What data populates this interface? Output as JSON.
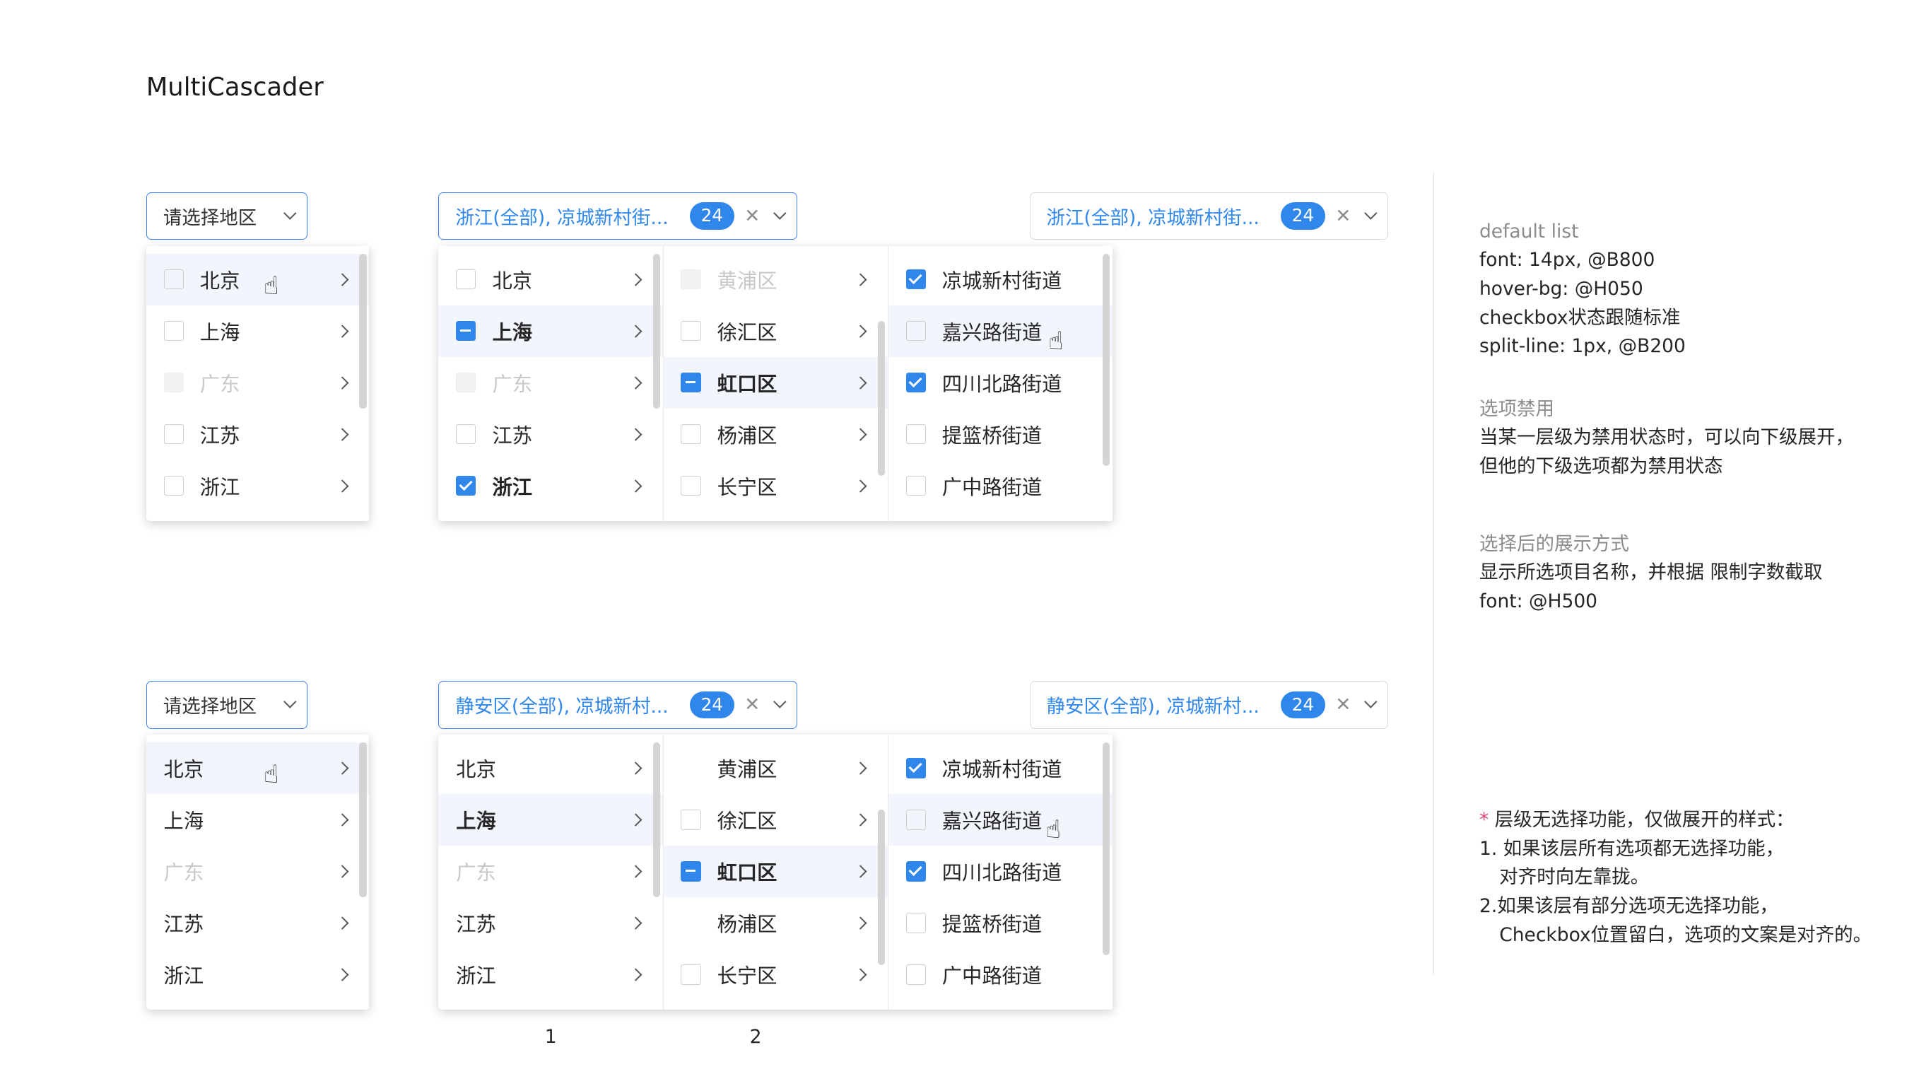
{
  "title": "MultiCascader",
  "placeholder": "请选择地区",
  "values": {
    "zj": "浙江(全部), 凉城新村街...",
    "ja": "静安区(全部), 凉城新村...",
    "count": "24"
  },
  "provinces": [
    "北京",
    "上海",
    "广东",
    "江苏",
    "浙江"
  ],
  "districts_top": [
    "黄浦区",
    "徐汇区",
    "虹口区",
    "杨浦区",
    "长宁区"
  ],
  "streets": [
    "凉城新村街道",
    "嘉兴路街道",
    "四川北路街道",
    "提篮桥街道",
    "广中路街道"
  ],
  "notes": {
    "n1": {
      "h": "default list",
      "l1": "font: 14px, @B800",
      "l2": "hover-bg: @H050",
      "l3": "checkbox状态跟随标准",
      "l4": "split-line: 1px, @B200"
    },
    "n2": {
      "h": "选项禁用",
      "l1": "当某一层级为禁用状态时，可以向下级展开，",
      "l2": "但他的下级选项都为禁用状态"
    },
    "n3": {
      "h": "选择后的展示方式",
      "l1": "显示所选项目名称，并根据 限制字数截取",
      "l2": "font: @H500"
    },
    "n4": {
      "star": "*",
      "l0": " 层级无选择功能，仅做展开的样式：",
      "l1": "1. 如果该层所有选项都无选择功能，",
      "l2": "对齐时向左靠拢。",
      "l3": "2.如果该层有部分选项无选择功能，",
      "l4": "Checkbox位置留白，选项的文案是对齐的。"
    }
  },
  "footnotes": {
    "a": "1",
    "b": "2"
  },
  "colors": {
    "accent": "#2f86eb",
    "hover_bg": "#f2f6fc",
    "star": "#e0457b"
  }
}
